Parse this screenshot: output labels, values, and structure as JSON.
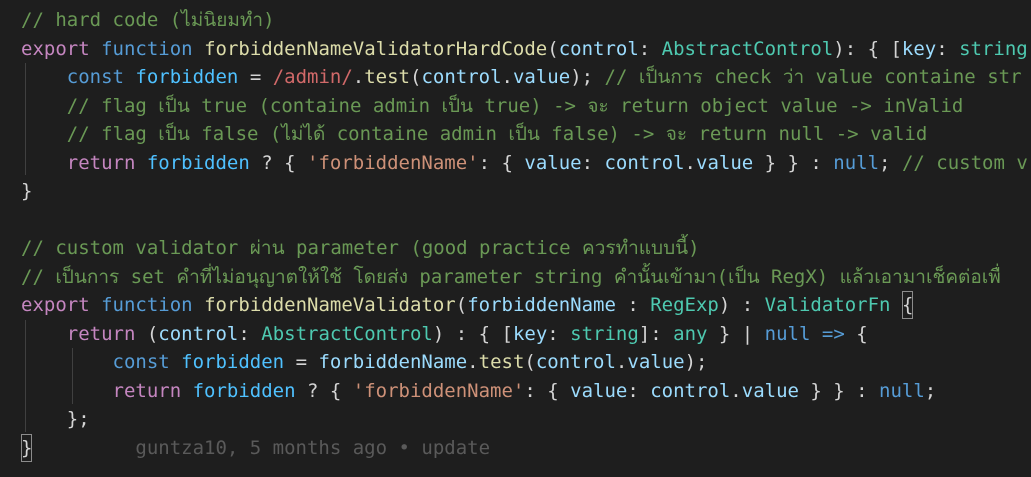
{
  "editor": {
    "theme": {
      "background": "#1e1e1e"
    },
    "lines": [
      {
        "tokens": [
          {
            "t": "// hard code (ไม่นิยมทำ)",
            "c": "#6a9955"
          }
        ]
      },
      {
        "tokens": [
          {
            "t": "export",
            "c": "#c586c0"
          },
          {
            "t": " "
          },
          {
            "t": "function",
            "c": "#569cd6"
          },
          {
            "t": " "
          },
          {
            "t": "forbiddenNameValidatorHardCode",
            "c": "#dcdcaa"
          },
          {
            "t": "(",
            "c": "#d4d4d4"
          },
          {
            "t": "control",
            "c": "#9cdcfe"
          },
          {
            "t": ": ",
            "c": "#d4d4d4"
          },
          {
            "t": "AbstractControl",
            "c": "#4ec9b0"
          },
          {
            "t": "): { [",
            "c": "#d4d4d4"
          },
          {
            "t": "key",
            "c": "#9cdcfe"
          },
          {
            "t": ": ",
            "c": "#d4d4d4"
          },
          {
            "t": "string",
            "c": "#4ec9b0"
          }
        ]
      },
      {
        "tokens": [
          {
            "t": "    "
          },
          {
            "t": "const",
            "c": "#569cd6"
          },
          {
            "t": " "
          },
          {
            "t": "forbidden",
            "c": "#4fc1ff"
          },
          {
            "t": " = ",
            "c": "#d4d4d4"
          },
          {
            "t": "/admin/",
            "c": "#d16969"
          },
          {
            "t": ".",
            "c": "#d4d4d4"
          },
          {
            "t": "test",
            "c": "#dcdcaa"
          },
          {
            "t": "(",
            "c": "#d4d4d4"
          },
          {
            "t": "control",
            "c": "#9cdcfe"
          },
          {
            "t": ".",
            "c": "#d4d4d4"
          },
          {
            "t": "value",
            "c": "#9cdcfe"
          },
          {
            "t": "); ",
            "c": "#d4d4d4"
          },
          {
            "t": "// เป็นการ check ว่า value containe str",
            "c": "#6a9955"
          }
        ]
      },
      {
        "tokens": [
          {
            "t": "    "
          },
          {
            "t": "// flag เป็น true (containe admin เป็น true) -> จะ return object value -> inValid",
            "c": "#6a9955"
          }
        ]
      },
      {
        "tokens": [
          {
            "t": "    "
          },
          {
            "t": "// flag เป็น false (ไม่ได้ containe admin เป็น false) -> จะ return null -> valid",
            "c": "#6a9955"
          }
        ]
      },
      {
        "tokens": [
          {
            "t": "    "
          },
          {
            "t": "return",
            "c": "#c586c0"
          },
          {
            "t": " "
          },
          {
            "t": "forbidden",
            "c": "#4fc1ff"
          },
          {
            "t": " ? { ",
            "c": "#d4d4d4"
          },
          {
            "t": "'forbiddenName'",
            "c": "#ce9178"
          },
          {
            "t": ": { ",
            "c": "#d4d4d4"
          },
          {
            "t": "value",
            "c": "#9cdcfe"
          },
          {
            "t": ": ",
            "c": "#d4d4d4"
          },
          {
            "t": "control",
            "c": "#9cdcfe"
          },
          {
            "t": ".",
            "c": "#d4d4d4"
          },
          {
            "t": "value",
            "c": "#9cdcfe"
          },
          {
            "t": " } } : ",
            "c": "#d4d4d4"
          },
          {
            "t": "null",
            "c": "#569cd6"
          },
          {
            "t": "; ",
            "c": "#d4d4d4"
          },
          {
            "t": "// custom v",
            "c": "#6a9955"
          }
        ]
      },
      {
        "tokens": [
          {
            "t": "}",
            "c": "#d4d4d4"
          }
        ]
      },
      {
        "tokens": []
      },
      {
        "tokens": [
          {
            "t": "// custom validator ผ่าน parameter (good practice ควรทำแบบนี้)",
            "c": "#6a9955"
          }
        ]
      },
      {
        "tokens": [
          {
            "t": "// เป็นการ set คำที่ไม่อนุญาตให้ใช้ โดยส่ง parameter string คำนั้นเข้ามา(เป็น RegX) แล้วเอามาเช็คต่อเพื่",
            "c": "#6a9955"
          }
        ]
      },
      {
        "tokens": [
          {
            "t": "export",
            "c": "#c586c0"
          },
          {
            "t": " "
          },
          {
            "t": "function",
            "c": "#569cd6"
          },
          {
            "t": " "
          },
          {
            "t": "forbiddenNameValidator",
            "c": "#dcdcaa"
          },
          {
            "t": "(",
            "c": "#d4d4d4"
          },
          {
            "t": "forbiddenName",
            "c": "#9cdcfe"
          },
          {
            "t": " : ",
            "c": "#d4d4d4"
          },
          {
            "t": "RegExp",
            "c": "#4ec9b0"
          },
          {
            "t": ") : ",
            "c": "#d4d4d4"
          },
          {
            "t": "ValidatorFn",
            "c": "#4ec9b0"
          },
          {
            "t": " "
          },
          {
            "t": "{",
            "c": "#d4d4d4",
            "box": true
          }
        ]
      },
      {
        "tokens": [
          {
            "t": "    "
          },
          {
            "t": "return",
            "c": "#c586c0"
          },
          {
            "t": " (",
            "c": "#d4d4d4"
          },
          {
            "t": "control",
            "c": "#9cdcfe"
          },
          {
            "t": ": ",
            "c": "#d4d4d4"
          },
          {
            "t": "AbstractControl",
            "c": "#4ec9b0"
          },
          {
            "t": ") : { [",
            "c": "#d4d4d4"
          },
          {
            "t": "key",
            "c": "#9cdcfe"
          },
          {
            "t": ": ",
            "c": "#d4d4d4"
          },
          {
            "t": "string",
            "c": "#4ec9b0"
          },
          {
            "t": "]: ",
            "c": "#d4d4d4"
          },
          {
            "t": "any",
            "c": "#4ec9b0"
          },
          {
            "t": " } | ",
            "c": "#d4d4d4"
          },
          {
            "t": "null",
            "c": "#569cd6"
          },
          {
            "t": " "
          },
          {
            "t": "=>",
            "c": "#569cd6"
          },
          {
            "t": " {",
            "c": "#d4d4d4"
          }
        ]
      },
      {
        "tokens": [
          {
            "t": "        "
          },
          {
            "t": "const",
            "c": "#569cd6"
          },
          {
            "t": " "
          },
          {
            "t": "forbidden",
            "c": "#4fc1ff"
          },
          {
            "t": " = ",
            "c": "#d4d4d4"
          },
          {
            "t": "forbiddenName",
            "c": "#9cdcfe"
          },
          {
            "t": ".",
            "c": "#d4d4d4"
          },
          {
            "t": "test",
            "c": "#dcdcaa"
          },
          {
            "t": "(",
            "c": "#d4d4d4"
          },
          {
            "t": "control",
            "c": "#9cdcfe"
          },
          {
            "t": ".",
            "c": "#d4d4d4"
          },
          {
            "t": "value",
            "c": "#9cdcfe"
          },
          {
            "t": ");",
            "c": "#d4d4d4"
          }
        ]
      },
      {
        "tokens": [
          {
            "t": "        "
          },
          {
            "t": "return",
            "c": "#c586c0"
          },
          {
            "t": " "
          },
          {
            "t": "forbidden",
            "c": "#4fc1ff"
          },
          {
            "t": " ? { ",
            "c": "#d4d4d4"
          },
          {
            "t": "'forbiddenName'",
            "c": "#ce9178"
          },
          {
            "t": ": { ",
            "c": "#d4d4d4"
          },
          {
            "t": "value",
            "c": "#9cdcfe"
          },
          {
            "t": ": ",
            "c": "#d4d4d4"
          },
          {
            "t": "control",
            "c": "#9cdcfe"
          },
          {
            "t": ".",
            "c": "#d4d4d4"
          },
          {
            "t": "value",
            "c": "#9cdcfe"
          },
          {
            "t": " } } : ",
            "c": "#d4d4d4"
          },
          {
            "t": "null",
            "c": "#569cd6"
          },
          {
            "t": ";",
            "c": "#d4d4d4"
          }
        ]
      },
      {
        "tokens": [
          {
            "t": "    "
          },
          {
            "t": "};",
            "c": "#d4d4d4"
          }
        ]
      },
      {
        "tokens": [
          {
            "t": "}",
            "c": "#d4d4d4",
            "box": true
          },
          {
            "t": "         "
          },
          {
            "t": "guntza10, 5 months ago • update",
            "c": "#5a5a5a",
            "blame": true
          }
        ]
      }
    ]
  }
}
